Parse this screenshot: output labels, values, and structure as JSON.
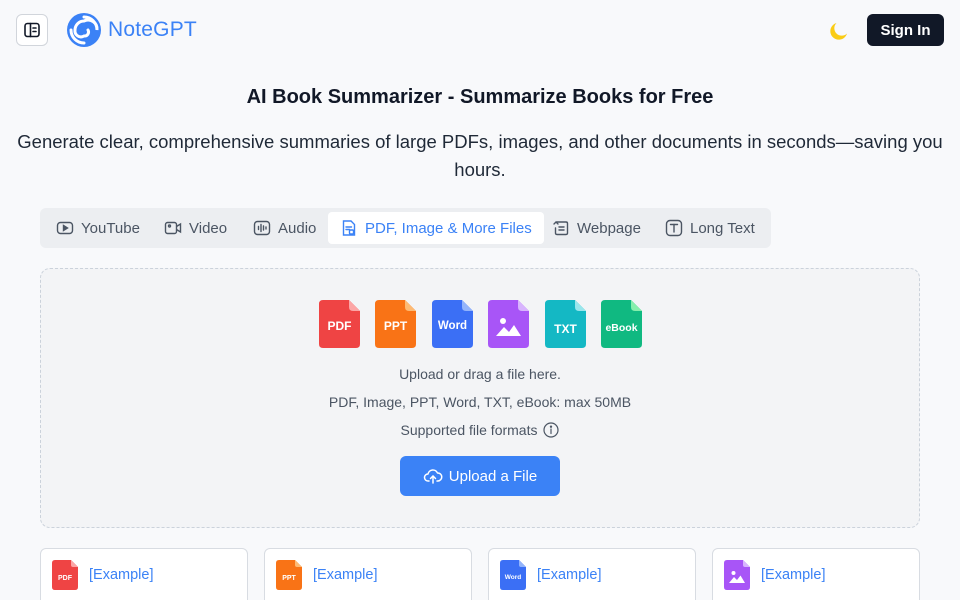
{
  "header": {
    "brand": "NoteGPT",
    "sign_in_label": "Sign In",
    "icons": [
      "sidebar-toggle-icon",
      "notegpt-logo-icon",
      "moon-icon"
    ]
  },
  "hero": {
    "title": "AI Book Summarizer - Summarize Books for Free",
    "subtitle": "Generate clear, comprehensive summaries of large PDFs, images, and other documents in seconds—saving you hours."
  },
  "tabs": [
    {
      "label": "YouTube",
      "icon": "youtube-icon",
      "active": false
    },
    {
      "label": "Video",
      "icon": "video-icon",
      "active": false
    },
    {
      "label": "Audio",
      "icon": "audio-icon",
      "active": false
    },
    {
      "label": "PDF, Image & More Files",
      "icon": "file-icon",
      "active": true
    },
    {
      "label": "Webpage",
      "icon": "webpage-icon",
      "active": false
    },
    {
      "label": "Long Text",
      "icon": "text-icon",
      "active": false
    }
  ],
  "upload": {
    "file_types": [
      {
        "label": "PDF",
        "color": "#ef4444"
      },
      {
        "label": "PPT",
        "color": "#f97316"
      },
      {
        "label": "Word",
        "color": "#3b6ff5"
      },
      {
        "label": "",
        "color": "#a855f7",
        "icon": "image-icon"
      },
      {
        "label": "TXT",
        "color": "#14b8c4"
      },
      {
        "label": "eBook",
        "color": "#10b981"
      }
    ],
    "line1": "Upload or drag a file here.",
    "line2": "PDF, Image, PPT, Word, TXT, eBook: max 50MB",
    "line3": "Supported file formats",
    "button_label": "Upload a File"
  },
  "examples": [
    {
      "label": "[Example]",
      "type": "PDF",
      "color": "#ef4444"
    },
    {
      "label": "[Example]",
      "type": "PPT",
      "color": "#f97316"
    },
    {
      "label": "[Example]",
      "type": "Word",
      "color": "#3b6ff5"
    },
    {
      "label": "[Example]",
      "type": "",
      "color": "#a855f7"
    }
  ],
  "colors": {
    "accent": "#3b82f6",
    "dark_button": "#111827",
    "moon": "#facc15"
  }
}
